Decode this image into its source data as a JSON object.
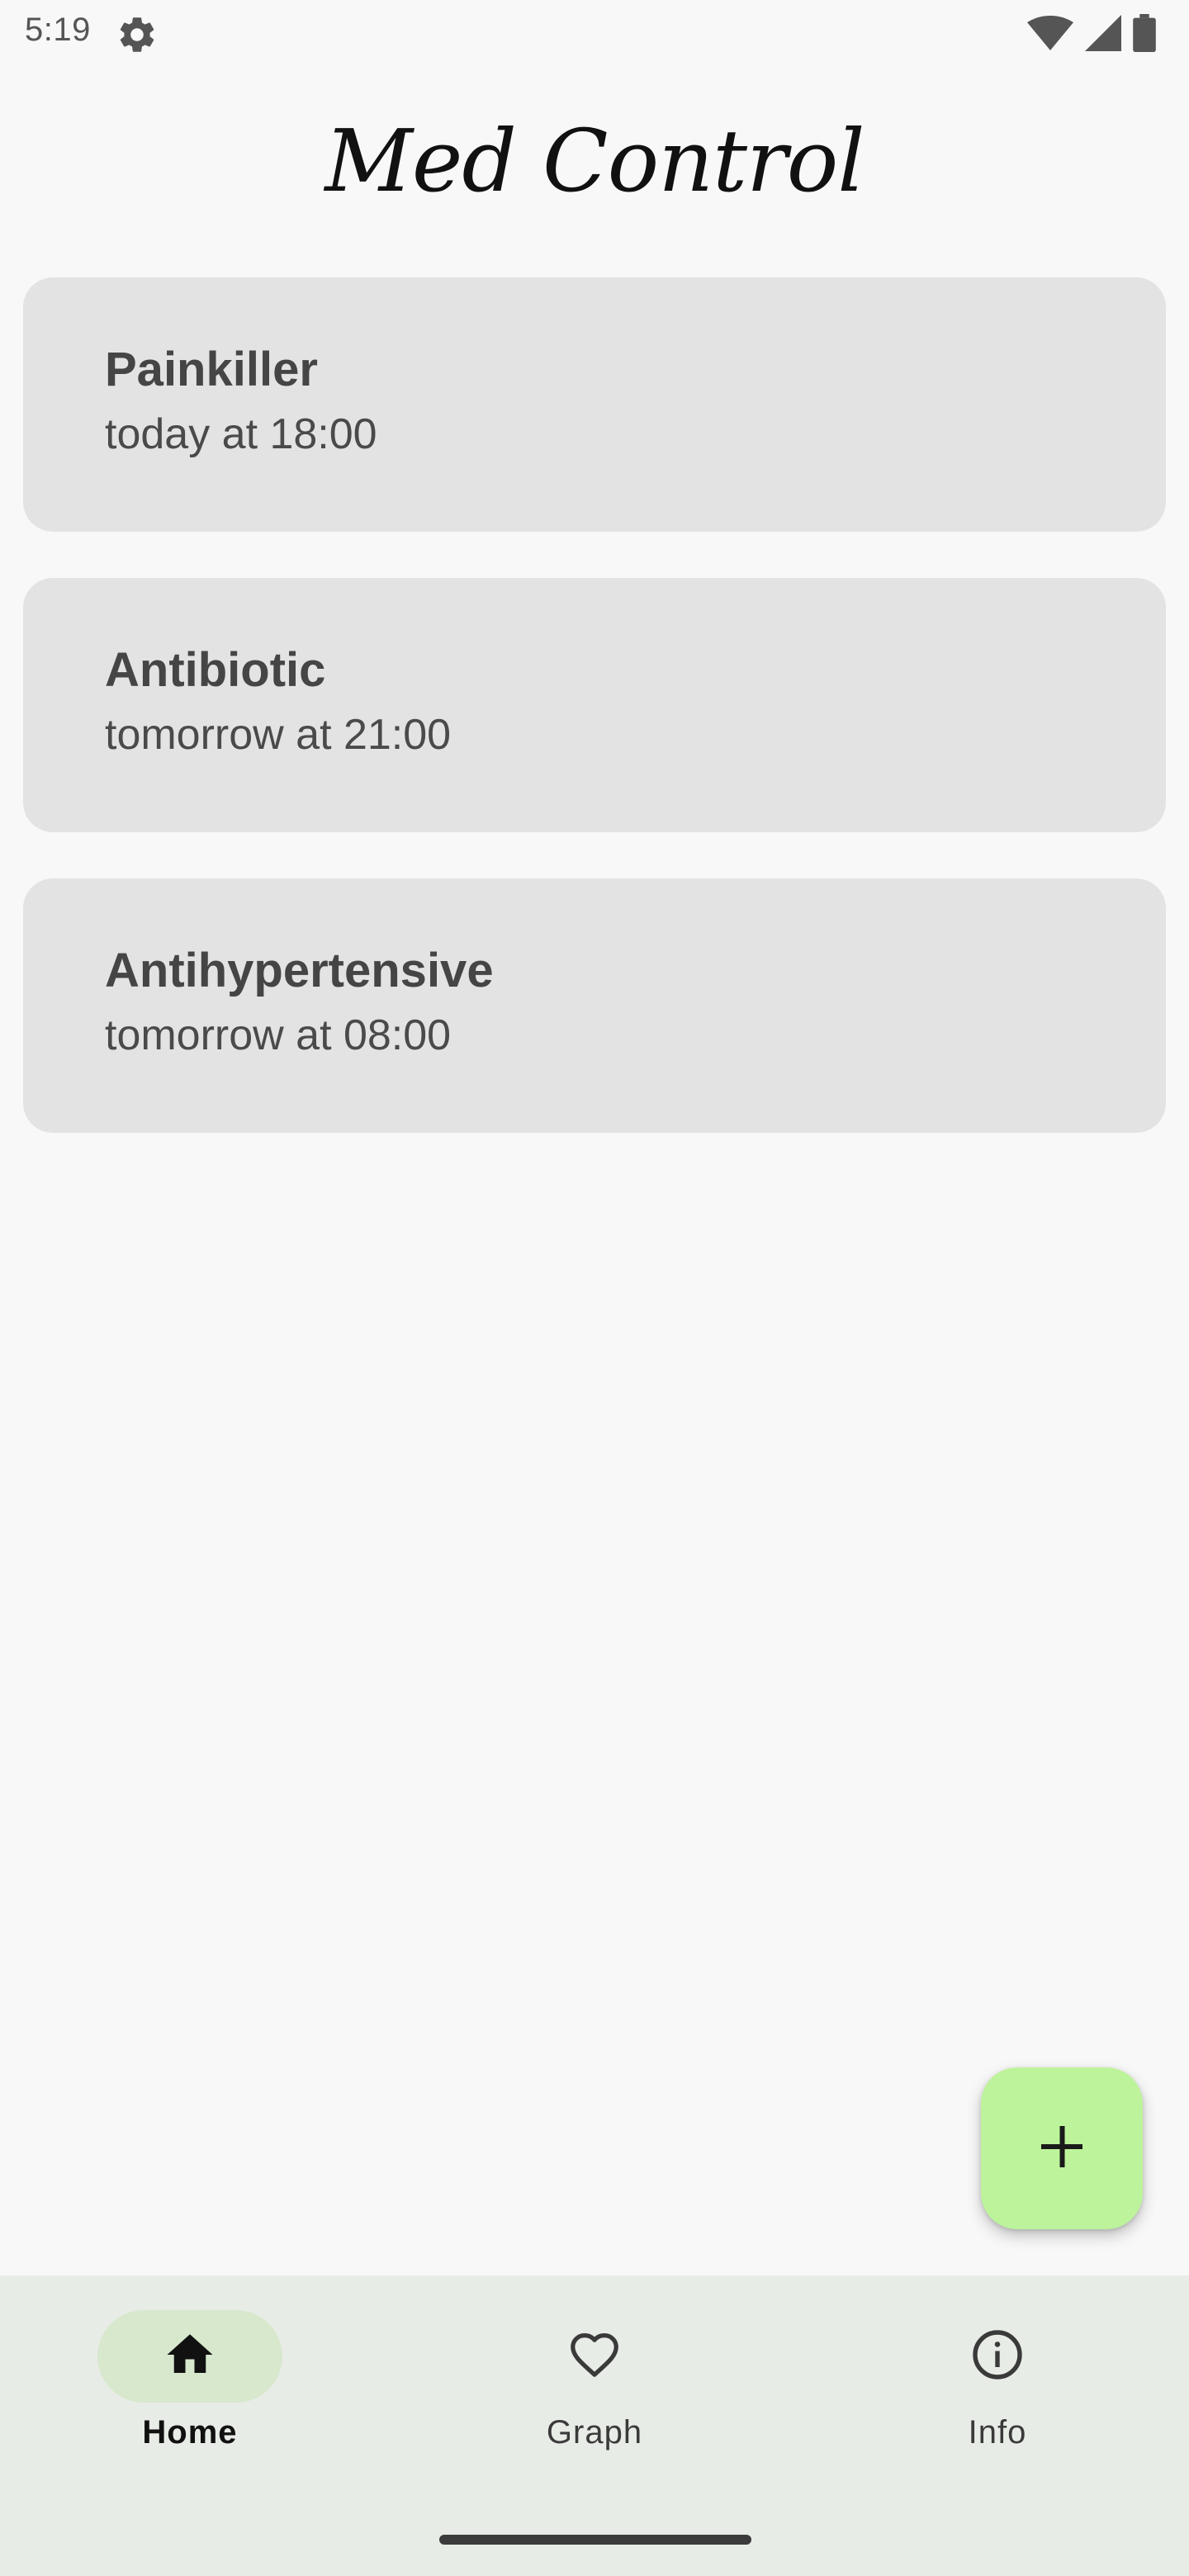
{
  "status_bar": {
    "time": "5:19",
    "icons": [
      "settings-gear-icon",
      "wifi-icon",
      "cell-signal-icon",
      "battery-icon"
    ]
  },
  "app": {
    "title": "Med Control"
  },
  "medications": [
    {
      "name": "Painkiller",
      "schedule": "today at 18:00"
    },
    {
      "name": "Antibiotic",
      "schedule": "tomorrow at 21:00"
    },
    {
      "name": "Antihypertensive",
      "schedule": "tomorrow at 08:00"
    }
  ],
  "fab": {
    "icon": "plus-icon",
    "color": "#bdf49b"
  },
  "bottom_nav": {
    "items": [
      {
        "label": "Home",
        "icon": "home-icon",
        "active": true
      },
      {
        "label": "Graph",
        "icon": "heart-icon",
        "active": false
      },
      {
        "label": "Info",
        "icon": "info-icon",
        "active": false
      }
    ],
    "active_pill_color": "#d7e8cd"
  },
  "colors": {
    "background": "#f8f8f8",
    "card": "#e3e3e3",
    "nav_background": "#e8ece6"
  }
}
